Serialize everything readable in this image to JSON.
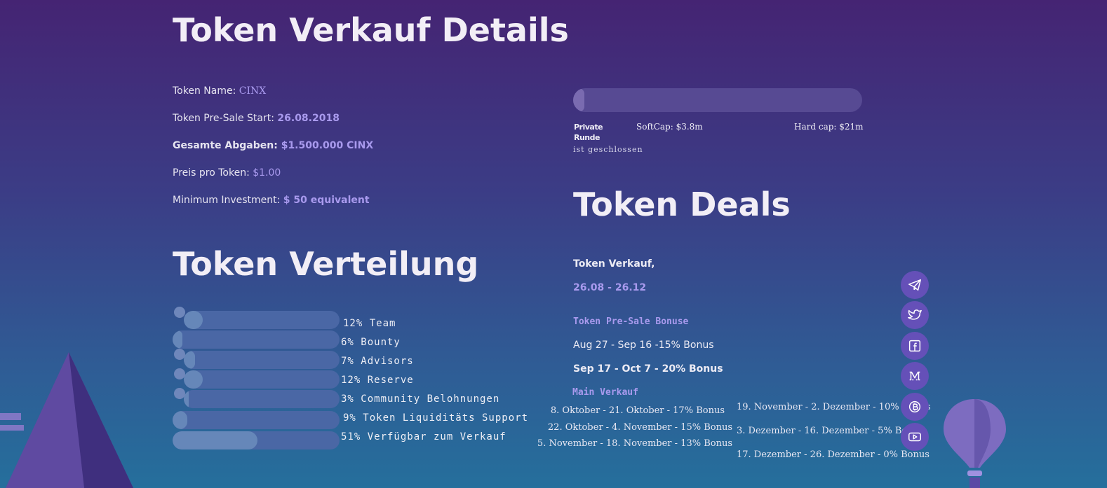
{
  "details": {
    "title": "Token Verkauf Details",
    "rows": [
      {
        "label": "Token Name:",
        "value": "CINX"
      },
      {
        "label": "Token Pre-Sale Start:",
        "value": "26.08.2018"
      },
      {
        "label": "Gesamte Abgaben:",
        "value": "$1.500.000 CINX"
      },
      {
        "label": "Preis pro Token:",
        "value": "$1.00"
      },
      {
        "label": "Minimum Investment:",
        "value": "$ 50 equivalent"
      }
    ]
  },
  "progress": {
    "fraction": 0.04,
    "private_round_line1": "Private",
    "private_round_line2": "Runde",
    "closed_text": "ist geschlossen",
    "soft_cap": "SoftCap: $3.8m",
    "hard_cap": "Hard cap: $21m"
  },
  "distribution": {
    "title": "Token Verteilung",
    "items": [
      {
        "label": "12% Team",
        "percent": 12
      },
      {
        "label": "6% Bounty",
        "percent": 6
      },
      {
        "label": "7% Advisors",
        "percent": 7
      },
      {
        "label": "12% Reserve",
        "percent": 12
      },
      {
        "label": "3% Community Belohnungen",
        "percent": 3
      },
      {
        "label": "9% Token Liquiditäts Support",
        "percent": 9
      },
      {
        "label": "51% Verfügbar zum Verkauf",
        "percent": 51
      }
    ]
  },
  "deals": {
    "title": "Token Deals",
    "sale_label": "Token Verkauf,",
    "sale_dates": "26.08 -  26.12",
    "presale_heading": "Token Pre-Sale Bonuse",
    "presale_items": [
      "Aug 27 - Sep 16 -15% Bonus",
      "Sep 17 - Oct 7 -  20% Bonus"
    ],
    "main_heading": "Main Verkauf",
    "main_col1": [
      "8. Oktober - 21. Oktober - 17% Bonus",
      "22. Oktober - 4. November - 15% Bonus",
      "5. November - 18. November - 13% Bonus"
    ],
    "main_col2": [
      "19. November - 2. Dezember - 10% Bonus",
      "3. Dezember - 16. Dezember - 5% Bonus",
      "17. Dezember - 26. Dezember - 0% Bonus"
    ]
  },
  "social_icons": [
    "telegram-icon",
    "twitter-icon",
    "facebook-icon",
    "medium-icon",
    "bitcoin-icon",
    "youtube-icon"
  ],
  "colors": {
    "accent": "#a99aee",
    "social_bg": "#6550b8",
    "bar_track": "#4a67a5",
    "bar_fill": "#6687b9"
  }
}
